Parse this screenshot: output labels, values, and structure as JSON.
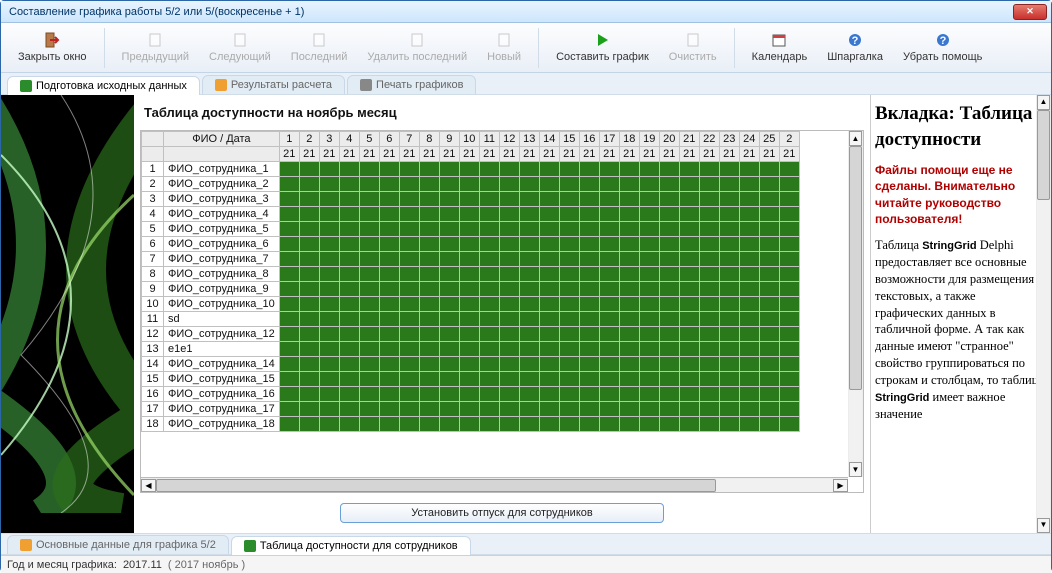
{
  "window": {
    "title": "Составление графика работы 5/2 или 5/(воскресенье + 1)"
  },
  "toolbar": {
    "items": [
      {
        "label": "Закрыть окно",
        "icon": "close-door-icon",
        "enabled": true
      },
      {
        "sep": true
      },
      {
        "label": "Предыдущий",
        "icon": "page-prev-icon",
        "enabled": false
      },
      {
        "label": "Следующий",
        "icon": "page-next-icon",
        "enabled": false
      },
      {
        "label": "Последний",
        "icon": "page-last-icon",
        "enabled": false
      },
      {
        "label": "Удалить последний",
        "icon": "page-delete-icon",
        "enabled": false
      },
      {
        "label": "Новый",
        "icon": "page-new-icon",
        "enabled": false
      },
      {
        "sep": true
      },
      {
        "label": "Составить график",
        "icon": "run-icon",
        "enabled": true
      },
      {
        "label": "Очистить",
        "icon": "clear-icon",
        "enabled": false
      },
      {
        "sep": true
      },
      {
        "label": "Календарь",
        "icon": "calendar-icon",
        "enabled": true
      },
      {
        "label": "Шпаргалка",
        "icon": "hint-icon",
        "enabled": true
      },
      {
        "label": "Убрать помощь",
        "icon": "help-off-icon",
        "enabled": true
      }
    ]
  },
  "top_tabs": [
    {
      "label": "Подготовка исходных данных",
      "icon": "green",
      "active": true
    },
    {
      "label": "Результаты расчета",
      "icon": "orange",
      "active": false
    },
    {
      "label": "Печать графиков",
      "icon": "printer",
      "active": false
    }
  ],
  "grid": {
    "title": "Таблица доступности на ноябрь месяц",
    "header_label": "ФИО / Дата",
    "days": [
      1,
      2,
      3,
      4,
      5,
      6,
      7,
      8,
      9,
      10,
      11,
      12,
      13,
      14,
      15,
      16,
      17,
      18,
      19,
      20,
      21,
      22,
      23,
      24,
      25,
      2
    ],
    "row2_value": "21",
    "rows": [
      {
        "idx": 1,
        "name": "ФИО_сотрудника_1"
      },
      {
        "idx": 2,
        "name": "ФИО_сотрудника_2"
      },
      {
        "idx": 3,
        "name": "ФИО_сотрудника_3"
      },
      {
        "idx": 4,
        "name": "ФИО_сотрудника_4"
      },
      {
        "idx": 5,
        "name": "ФИО_сотрудника_5"
      },
      {
        "idx": 6,
        "name": "ФИО_сотрудника_6"
      },
      {
        "idx": 7,
        "name": "ФИО_сотрудника_7"
      },
      {
        "idx": 8,
        "name": "ФИО_сотрудника_8"
      },
      {
        "idx": 9,
        "name": "ФИО_сотрудника_9"
      },
      {
        "idx": 10,
        "name": "ФИО_сотрудника_10"
      },
      {
        "idx": 11,
        "name": "sd"
      },
      {
        "idx": 12,
        "name": "ФИО_сотрудника_12"
      },
      {
        "idx": 13,
        "name": "e1e1"
      },
      {
        "idx": 14,
        "name": "ФИО_сотрудника_14"
      },
      {
        "idx": 15,
        "name": "ФИО_сотрудника_15"
      },
      {
        "idx": 16,
        "name": "ФИО_сотрудника_16"
      },
      {
        "idx": 17,
        "name": "ФИО_сотрудника_17"
      },
      {
        "idx": 18,
        "name": "ФИО_сотрудника_18"
      }
    ]
  },
  "button": {
    "label": "Установить отпуск для сотрудников"
  },
  "help": {
    "title": "Вкладка: Таблица доступности",
    "warning": "Файлы помощи еще не сделаны. Внимательно читайте руководство пользователя!",
    "body": "Таблица StringGrid Delphi предоставляет все основные возможности для размещения текстовых, а также графических данных в табличной форме. А так как данные имеют \"странное\" свойство группироваться по строкам и столбцам, то таблица StringGrid имеет важное значение"
  },
  "bottom_tabs": [
    {
      "label": "Основные данные для графика 5/2",
      "icon": "orange",
      "active": false
    },
    {
      "label": "Таблица доступности для сотрудников",
      "icon": "green",
      "active": true
    }
  ],
  "status": {
    "label": "Год и месяц графика:",
    "value": "2017.11",
    "bracket": "( 2017  ноябрь )"
  }
}
